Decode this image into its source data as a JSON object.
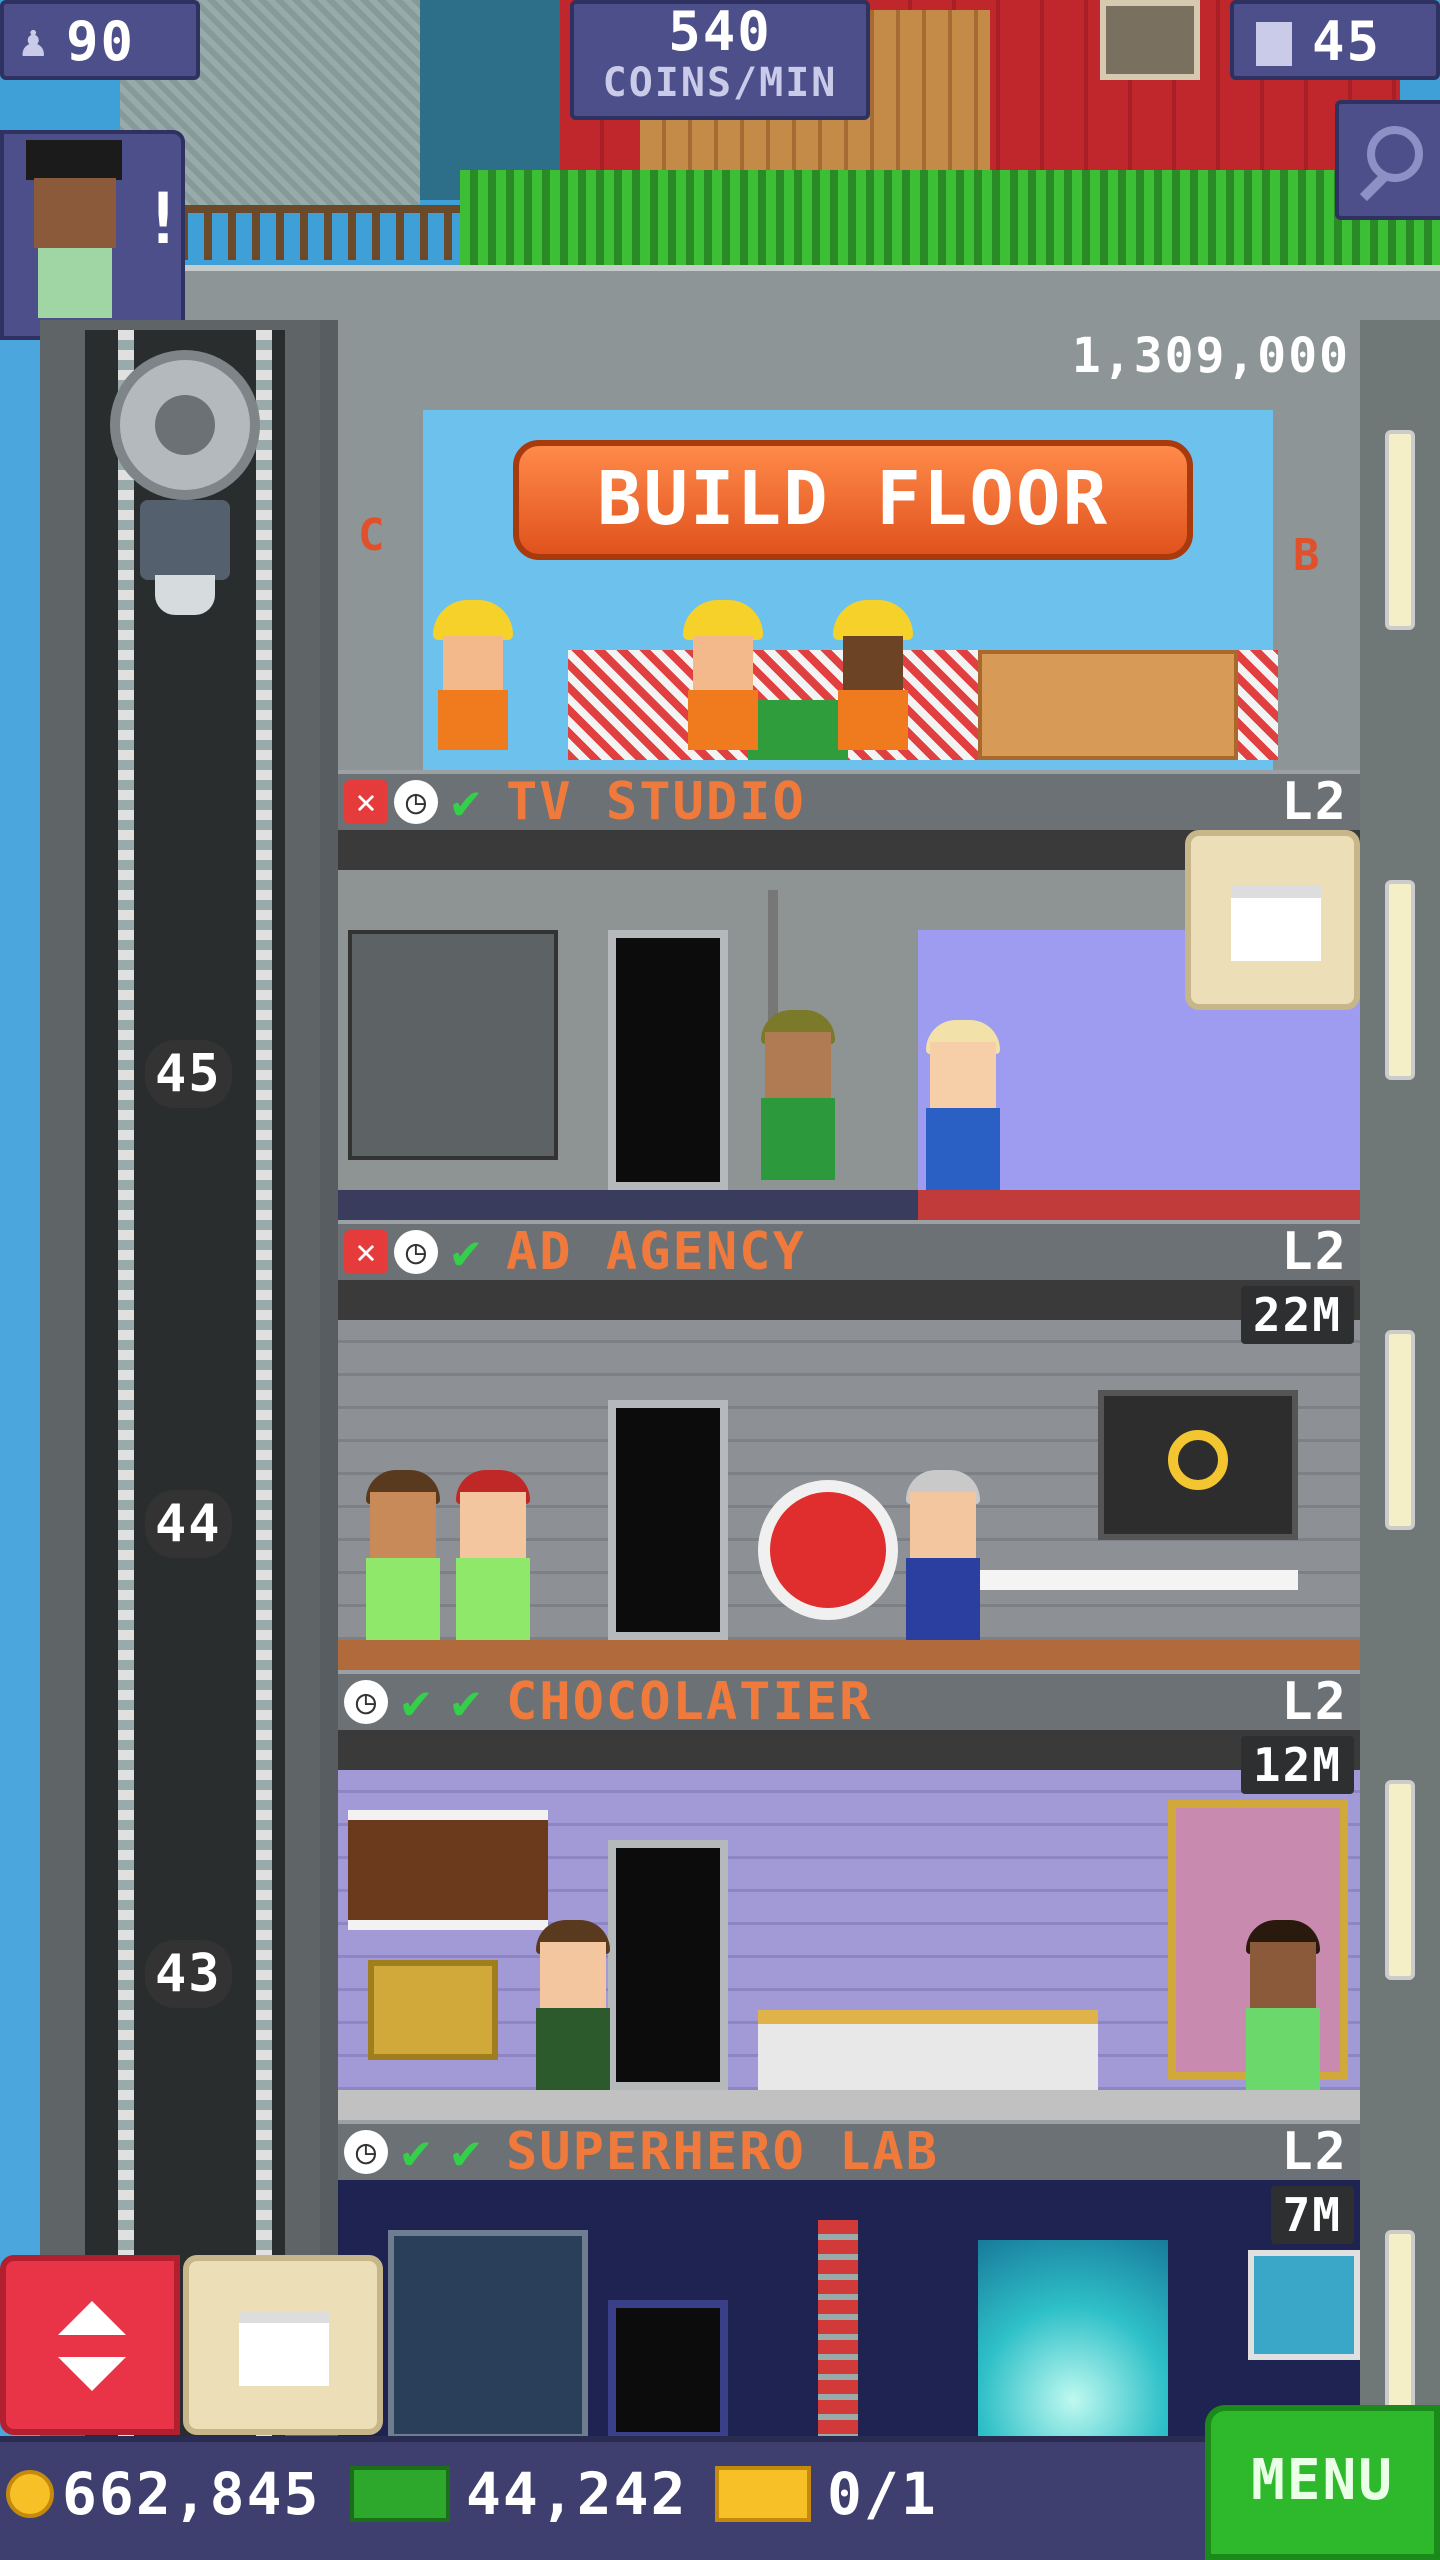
{
  "hud": {
    "population": "90",
    "coins_per_min_value": "540",
    "coins_per_min_label": "COINS/MIN",
    "floor_count": "45"
  },
  "build_floor": {
    "cost": "1,309,000",
    "button_label": "BUILD FLOOR",
    "side_letter_left": "C",
    "side_letter_right": "B"
  },
  "elevator": {
    "floor_labels": [
      "45",
      "44",
      "43"
    ]
  },
  "floors": [
    {
      "name": "TV STUDIO",
      "level": "L2",
      "value": "",
      "icons": [
        "x",
        "clock",
        "check"
      ]
    },
    {
      "name": "AD AGENCY",
      "level": "L2",
      "value": "22M",
      "icons": [
        "x",
        "clock",
        "check"
      ]
    },
    {
      "name": "CHOCOLATIER",
      "level": "L2",
      "value": "12M",
      "icons": [
        "clock",
        "check",
        "check"
      ]
    },
    {
      "name": "SUPERHERO LAB",
      "level": "L2",
      "value": "7M",
      "icons": [
        "clock",
        "check",
        "check"
      ]
    }
  ],
  "bottom": {
    "coins": "662,845",
    "bux": "44,242",
    "tickets": "0/1",
    "menu_label": "MENU"
  },
  "colors": {
    "floor_name": "#f07a3c",
    "hud_bg": "#4c4f8a",
    "menu_green": "#2eb82b",
    "elevator_red": "#e83446"
  }
}
